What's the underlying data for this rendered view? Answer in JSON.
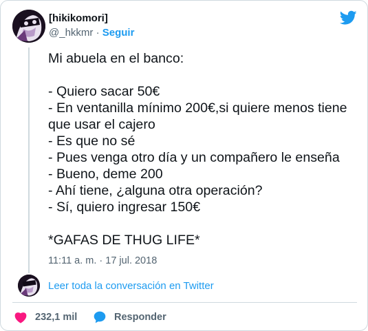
{
  "author": {
    "display_name": "[hikikomori]",
    "handle": "@_hkkmr",
    "separator": "·",
    "follow_label": "Seguir"
  },
  "tweet": {
    "text": "Mi abuela en el banco:\n\n- Quiero sacar 50€\n- En ventanilla mínimo 200€,si quiere menos tiene que usar el cajero\n- Es que no sé\n- Pues venga otro día y un compañero le enseña\n- Bueno, deme 200\n- Ahí tiene, ¿alguna otra operación?\n- Sí, quiero ingresar 150€\n\n*GAFAS DE THUG LIFE*",
    "timestamp": "11:11 a. m. · 17 jul. 2018"
  },
  "conversation": {
    "link_label": "Leer toda la conversación en Twitter"
  },
  "actions": {
    "likes_count": "232,1 mil",
    "reply_label": "Responder"
  },
  "colors": {
    "accent": "#1d9bf0",
    "like": "#f91880",
    "text": "#0f1419",
    "muted": "#536471",
    "border": "#cfd9de"
  },
  "icons": {
    "brand": "twitter-bird-icon",
    "like": "heart-icon",
    "reply": "speech-bubble-icon"
  }
}
